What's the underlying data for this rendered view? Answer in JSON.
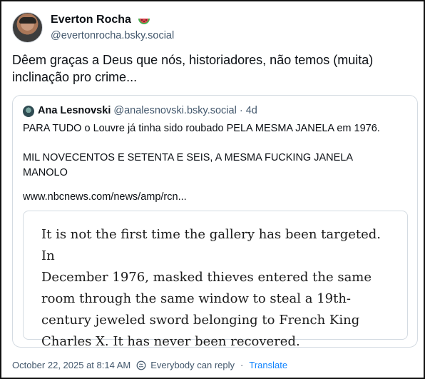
{
  "author": {
    "display_name": "Everton Rocha",
    "name_emoji": "watermelon-emoji",
    "handle": "@evertonrocha.bsky.social"
  },
  "post": {
    "lines": [
      "Dêem graças a Deus que nós, historiadores, não temos (muita)",
      "inclinação pro crime..."
    ]
  },
  "quote": {
    "display_name": "Ana Lesnovski",
    "handle": "@analesnovski.bsky.social",
    "separator": "·",
    "age": "4d",
    "lines": [
      "PARA TUDO o Louvre já tinha sido roubado PELA MESMA JANELA em 1976.",
      "",
      "MIL NOVECENTOS E SETENTA E SEIS, A MESMA FUCKING JANELA",
      "MANOLO"
    ],
    "link": "www.nbcnews.com/news/amp/rcn...",
    "image_text_lines": [
      "It is not the first time the gallery has been targeted. In",
      "December 1976, masked thieves entered the same",
      "room through the same window to steal a 19th-",
      "century jeweled sword belonging to French King",
      "Charles X. It has never been recovered."
    ]
  },
  "footer": {
    "timestamp": "October 22, 2025 at 8:14 AM",
    "reply_setting": "Everybody can reply",
    "separator": "·",
    "translate": "Translate"
  },
  "colors": {
    "accent": "#1083fe",
    "muted": "#42576c",
    "border": "#d4dbe2"
  }
}
